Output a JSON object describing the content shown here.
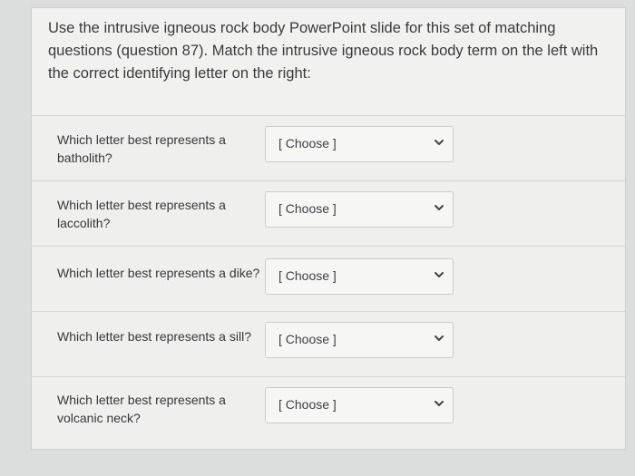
{
  "intro": {
    "text": "Use the intrusive igneous rock body PowerPoint slide for this set of matching questions (question 87).  Match the intrusive igneous rock body term on the left with the correct identifying letter on the right:"
  },
  "questions": [
    {
      "label": "Which letter best represents a batholith?",
      "selected": "[ Choose ]"
    },
    {
      "label": "Which letter best represents a laccolith?",
      "selected": "[ Choose ]"
    },
    {
      "label": "Which letter best represents a dike?",
      "selected": "[ Choose ]"
    },
    {
      "label": "Which letter best represents a sill?",
      "selected": "[ Choose ]"
    },
    {
      "label": "Which letter best represents a volcanic neck?",
      "selected": "[ Choose ]"
    }
  ]
}
